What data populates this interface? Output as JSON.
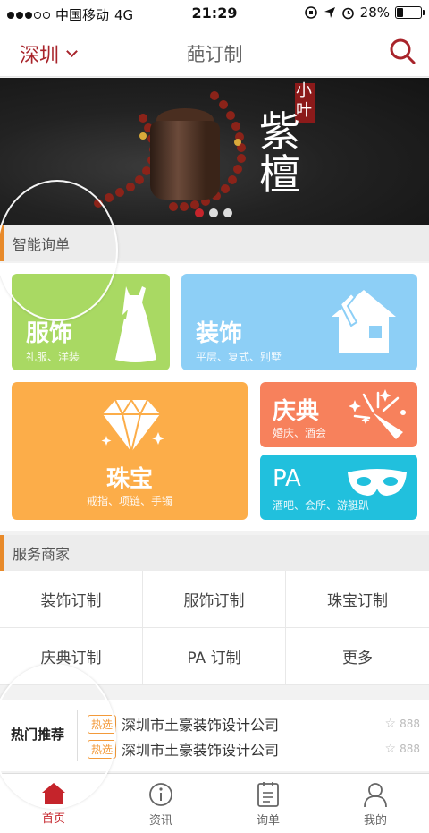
{
  "status_bar": {
    "carrier": "中国移动",
    "network": "4G",
    "time": "21:29",
    "battery_percent": "28%",
    "battery_level": 0.28
  },
  "nav": {
    "city": "深圳",
    "title": "葩订制",
    "search_icon": "search-icon"
  },
  "banner": {
    "small_text": "小叶",
    "big_text": "紫檀",
    "dots": 3,
    "active_dot": 0
  },
  "smart_inquiry": {
    "title": "智能询单",
    "tiles": [
      {
        "title": "服饰",
        "sub": "礼服、洋装",
        "icon": "dress-icon",
        "color": "#a9d963"
      },
      {
        "title": "装饰",
        "sub": "平层、复式、别墅",
        "icon": "house-icon",
        "color": "#8dcff6"
      },
      {
        "title": "珠宝",
        "sub": "戒指、项链、手镯",
        "icon": "diamond-icon",
        "color": "#fcad49"
      },
      {
        "title": "庆典",
        "sub": "婚庆、酒会",
        "icon": "party-popper-icon",
        "color": "#f7815c"
      },
      {
        "title": "PA",
        "sub": "酒吧、会所、游艇趴",
        "icon": "mask-icon",
        "color": "#21c0dd"
      }
    ]
  },
  "services": {
    "title": "服务商家",
    "items": [
      "装饰订制",
      "服饰订制",
      "珠宝订制",
      "庆典订制",
      "PA 订制",
      "更多"
    ]
  },
  "hot": {
    "label": "热门推荐",
    "items": [
      {
        "tag": "热选",
        "text": "深圳市土豪装饰设计公司",
        "count": "888"
      },
      {
        "tag": "热选",
        "text": "深圳市土豪装饰设计公司",
        "count": "888"
      }
    ]
  },
  "tabbar": {
    "items": [
      {
        "label": "首页",
        "icon": "home-icon",
        "active": true
      },
      {
        "label": "资讯",
        "icon": "info-icon",
        "active": false
      },
      {
        "label": "询单",
        "icon": "list-icon",
        "active": false
      },
      {
        "label": "我的",
        "icon": "user-icon",
        "active": false
      }
    ]
  },
  "colors": {
    "brand_red": "#c5242b",
    "section_accent": "#e88a2a"
  }
}
